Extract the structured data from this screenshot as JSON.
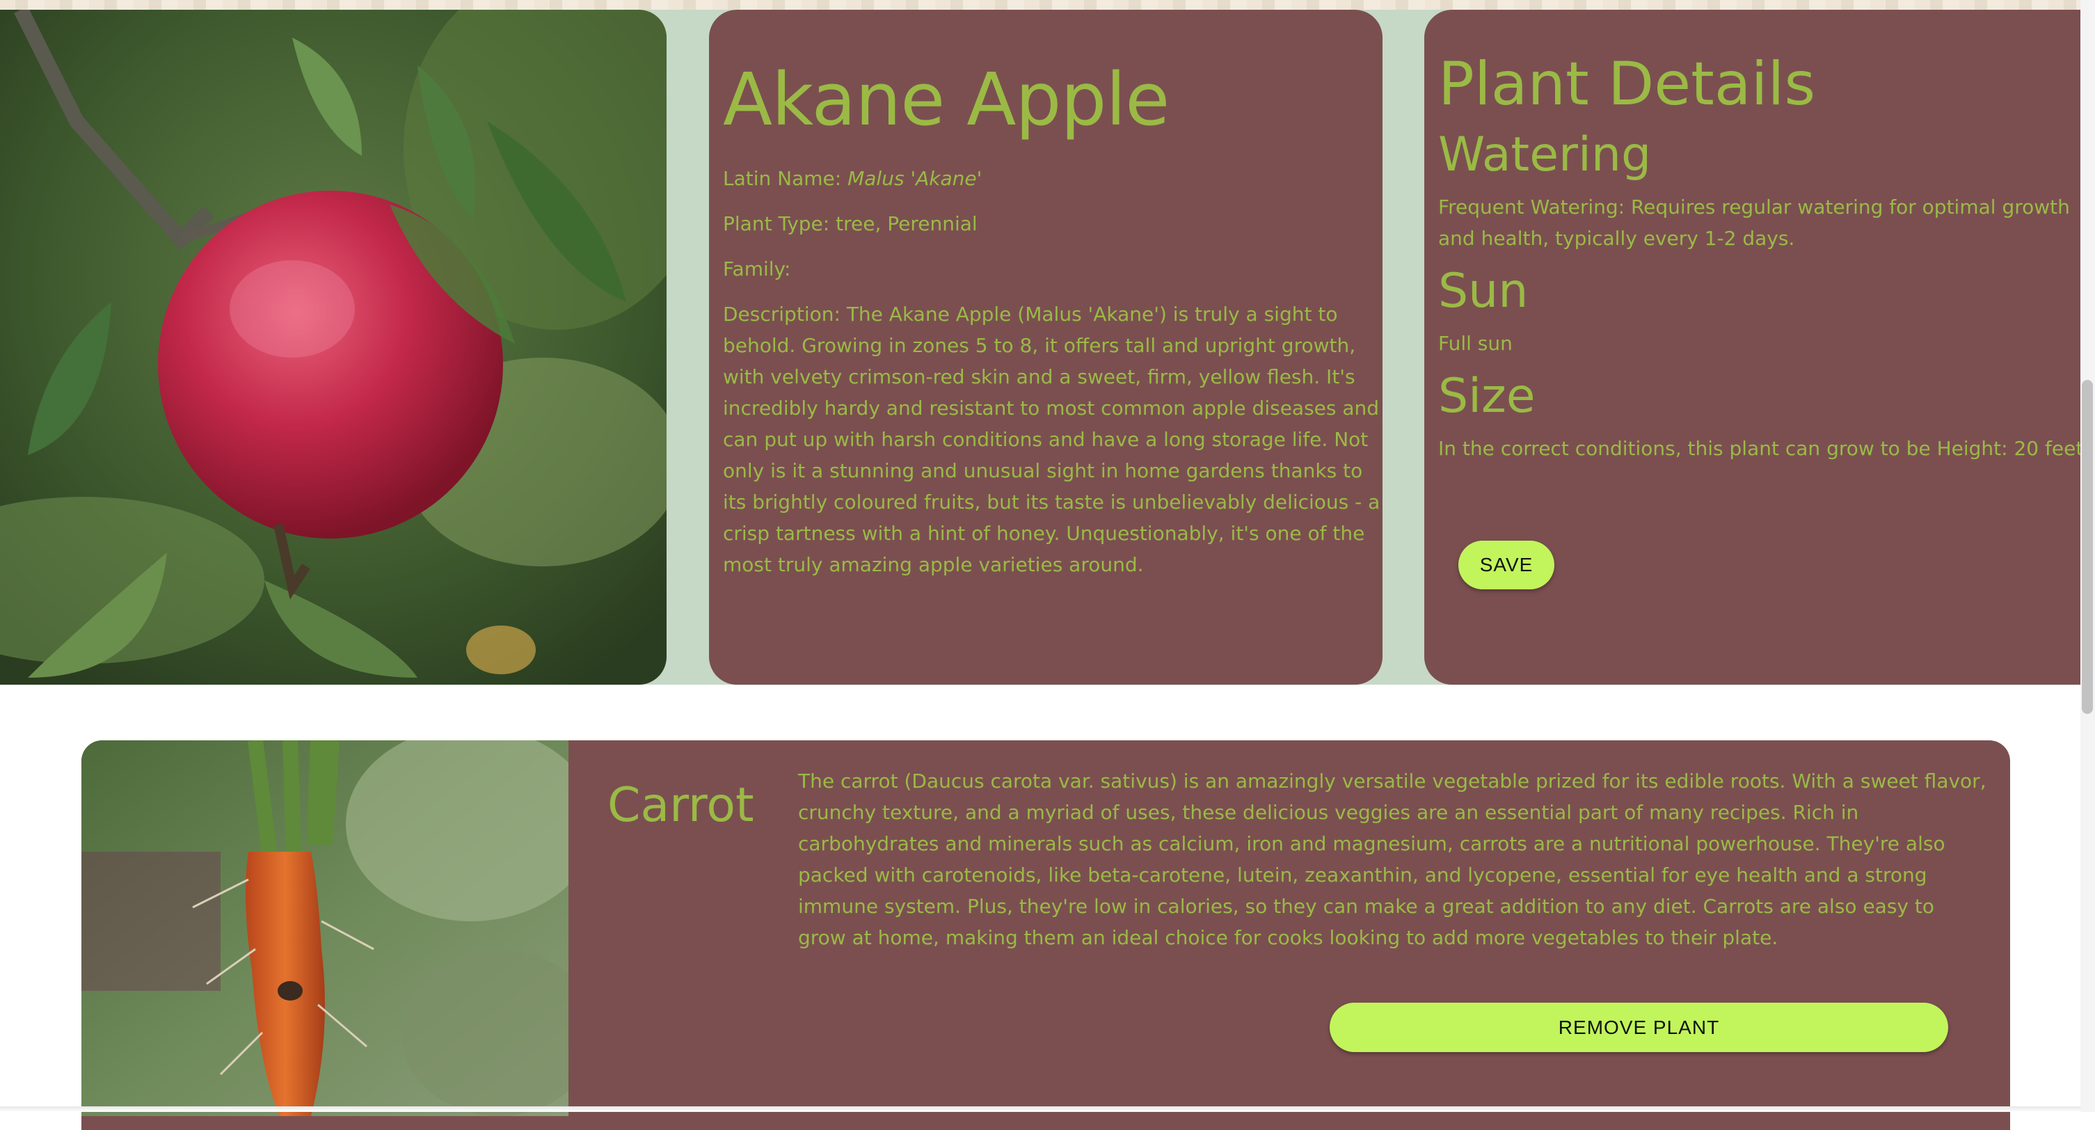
{
  "featured": {
    "name": "Akane Apple",
    "latin_label": "Latin Name:",
    "latin_value": "Malus 'Akane'",
    "type_label": "Plant Type:",
    "type_value": "tree, Perennial",
    "family_label": "Family:",
    "family_value": "",
    "description_label": "Description:",
    "description": "The Akane Apple (Malus 'Akane') is truly a sight to behold. Growing in zones 5 to 8, it offers tall and upright growth, with velvety crimson-red skin and a sweet, firm, yellow flesh. It's incredibly hardy and resistant to most common apple diseases and can put up with harsh conditions and have a long storage life. Not only is it a stunning and unusual sight in home gardens thanks to its brightly coloured fruits, but its taste is unbelievably delicious - a crisp tartness with a hint of honey. Unquestionably, it's one of the most truly amazing apple varieties around."
  },
  "details": {
    "title": "Plant Details",
    "watering_heading": "Watering",
    "watering_text": "Frequent Watering: Requires regular watering for optimal growth and health, typically every 1-2 days.",
    "sun_heading": "Sun",
    "sun_text": "Full sun",
    "size_heading": "Size",
    "size_text": "In the correct conditions, this plant can grow to be Height: 20 feet",
    "save_label": "SAVE"
  },
  "saved_plants": [
    {
      "name": "Carrot",
      "description": "The carrot (Daucus carota var. sativus) is an amazingly versatile vegetable prized for its edible roots. With a sweet flavor, crunchy texture, and a myriad of uses, these delicious veggies are an essential part of many recipes. Rich in carbohydrates and minerals such as calcium, iron and magnesium, carrots are a nutritional powerhouse. They're also packed with carotenoids, like beta-carotene, lutein, zeaxanthin, and lycopene, essential for eye health and a strong immune system. Plus, they're low in calories, so they can make a great addition to any diet. Carrots are also easy to grow at home, making them an ideal choice for cooks looking to add more vegetables to their plate.",
      "remove_label": "REMOVE PLANT"
    }
  ],
  "colors": {
    "card_bg": "#7b4f50",
    "text_green": "#9aba45",
    "button_lime": "#c1f55b",
    "band_bg": "#c6d8c6"
  }
}
